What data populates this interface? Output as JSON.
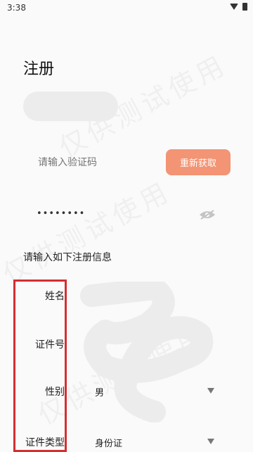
{
  "status": {
    "time": "3:38"
  },
  "title": "注册",
  "code": {
    "placeholder": "请输入验证码",
    "resend_label": "重新获取"
  },
  "password": {
    "masked": "••••••••"
  },
  "section_title": "请输入如下注册信息",
  "fields": [
    {
      "label": "姓名",
      "value": ""
    },
    {
      "label": "证件号",
      "value": ""
    },
    {
      "label": "性别",
      "value": "男"
    },
    {
      "label": "证件类型",
      "value": "身份证"
    }
  ],
  "watermark": "仅供测试使用",
  "colors": {
    "accent": "#f39474",
    "highlight": "#d32f2f"
  }
}
